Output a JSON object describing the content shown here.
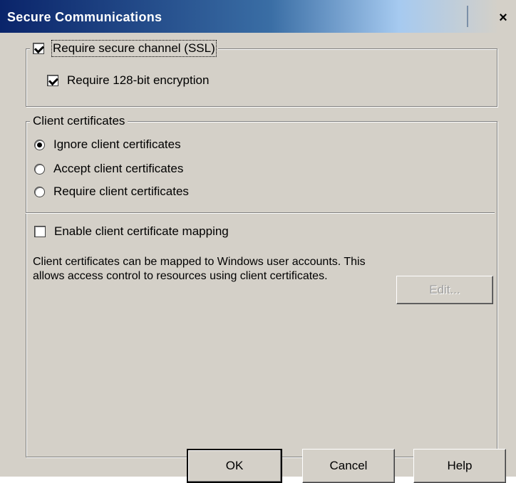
{
  "dialog": {
    "title": "Secure Communications",
    "close_glyph": "×"
  },
  "ssl": {
    "require_ssl_label": "Require secure channel (SSL)",
    "require_ssl_checked": true,
    "require_128_label": "Require 128-bit encryption",
    "require_128_checked": true
  },
  "client_certificates": {
    "group_label": "Client certificates",
    "options": [
      {
        "label": "Ignore client certificates",
        "selected": true
      },
      {
        "label": "Accept client certificates",
        "selected": false
      },
      {
        "label": "Require client certificates",
        "selected": false
      }
    ]
  },
  "mapping": {
    "enable_label": "Enable client certificate mapping",
    "enable_checked": false,
    "description": "Client certificates can be mapped to Windows user accounts.  This allows access control to resources using client certificates.",
    "edit_label": "Edit..."
  },
  "footer": {
    "ok_label": "OK",
    "cancel_label": "Cancel",
    "help_label": "Help"
  },
  "colors": {
    "title_bar": "#0a246a",
    "dialog_face": "#d4d0c8"
  },
  "icons": [
    "close-icon",
    "checkbox-icon",
    "radio-icon"
  ]
}
